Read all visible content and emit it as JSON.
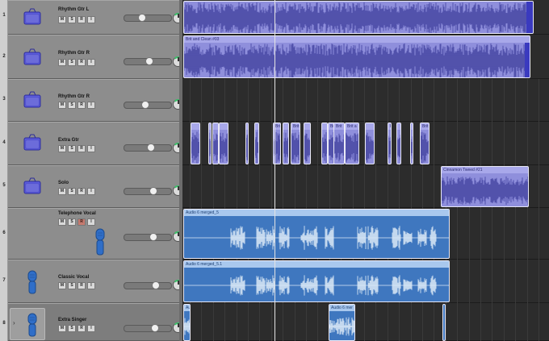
{
  "tracks": [
    {
      "number": "1",
      "name": "Rhythm Gtr L",
      "icon": "amp-icon",
      "buttons": [
        "M",
        "S",
        "R",
        "I"
      ],
      "volume": 0.53,
      "color": "#5c5cdc"
    },
    {
      "number": "2",
      "name": "Rhythm Gtr R",
      "icon": "amp-icon",
      "buttons": [
        "M",
        "S",
        "R",
        "I"
      ],
      "volume": 0.53,
      "color": "#5c5cdc"
    },
    {
      "number": "3",
      "name": "Rhythm Gtr R",
      "icon": "amp-icon",
      "buttons": [
        "M",
        "S",
        "R",
        "I"
      ],
      "volume": 0.44,
      "color": "#5c5cdc"
    },
    {
      "number": "4",
      "name": "Extra Gtr",
      "icon": "amp-icon",
      "buttons": [
        "M",
        "S",
        "R",
        "I"
      ],
      "volume": 0.58,
      "color": "#5c5cdc"
    },
    {
      "number": "5",
      "name": "Solo",
      "icon": "amp-icon",
      "buttons": [
        "M",
        "S",
        "R",
        "I"
      ],
      "volume": 0.64,
      "color": "#5c5cdc"
    },
    {
      "number": "6",
      "name": "Telephone Vocal",
      "icon": "microphone-icon",
      "buttons": [
        "M",
        "S",
        "R",
        "I"
      ],
      "volume": 0.64,
      "color": "#2f6ec8"
    },
    {
      "number": "7",
      "name": "Classic Vocal",
      "icon": "microphone-icon",
      "buttons": [
        "M",
        "S",
        "R",
        "I"
      ],
      "volume": 0.68,
      "color": "#2f6ec8"
    },
    {
      "number": "8",
      "name": "Extra Singer",
      "icon": "microphone-icon",
      "buttons": [
        "M",
        "S",
        "R",
        "I"
      ],
      "volume": 0.66,
      "color": "#2f6ec8"
    }
  ],
  "regions": {
    "t2": "Brit and Clean #03",
    "t5": "Cinnamon Tweed #21",
    "t6": "Audio 6 merged_5",
    "t7": "Audio 6 merged_5.1",
    "t8a": "Au",
    "t8b": "Audio 6 mer"
  },
  "t4_clips": [
    "",
    "",
    "",
    "",
    "",
    "",
    "Brit",
    "",
    "Brit",
    "",
    "",
    "Br",
    "Brit",
    "Brit a",
    "",
    "Brit",
    "",
    "",
    "",
    "Brit"
  ],
  "colors": {
    "guitar_region": "#8f8fdc",
    "vocal_region": "#3f77bf",
    "pan_ring": "#3cc46b",
    "playhead": "#e4e4e4"
  }
}
